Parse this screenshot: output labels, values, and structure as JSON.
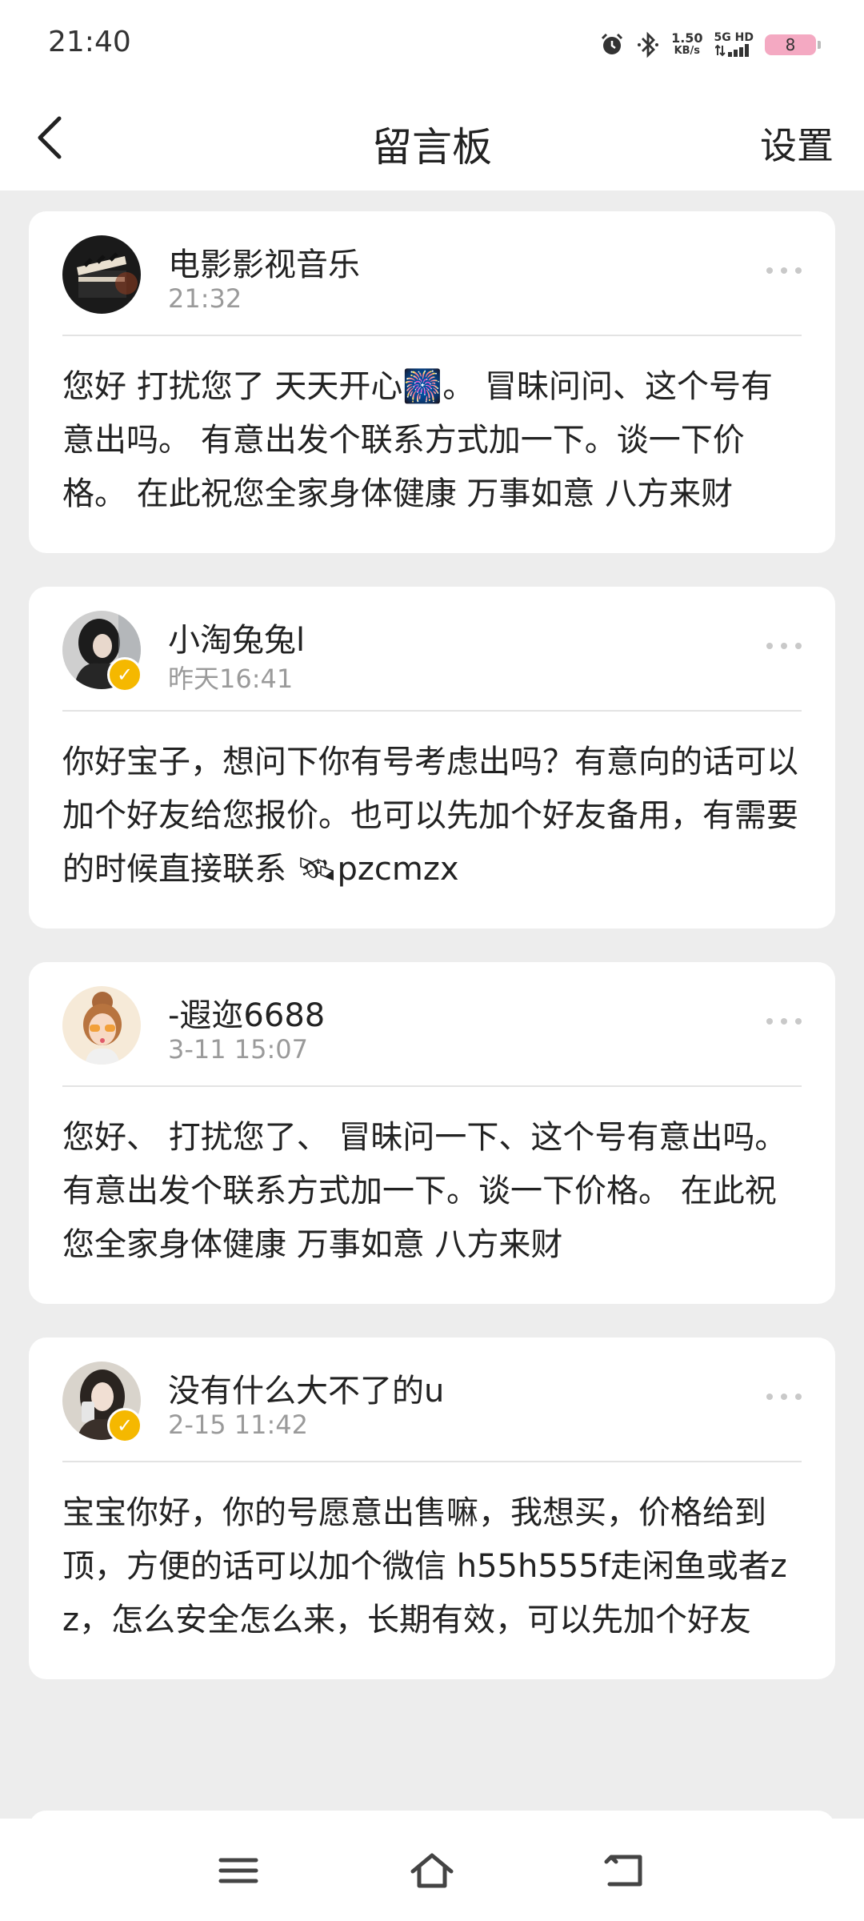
{
  "status": {
    "time": "21:40",
    "speed_value": "1.50",
    "speed_unit": "KB/s",
    "network": "5G HD",
    "battery": "8"
  },
  "header": {
    "title": "留言板",
    "settings_label": "设置"
  },
  "messages": [
    {
      "name": "电影影视音乐",
      "time": "21:32",
      "verified": false,
      "text": "您好 打扰您了  天天开心🎆。        冒昧问问、这个号有意出吗。  有意出发个联系方式加一下。谈一下价格。   在此祝您全家身体健康 万事如意 八方来财"
    },
    {
      "name": "小淘兔兔l",
      "time": "昨天16:41",
      "verified": true,
      "text": "你好宝子，想问下你有号考虑出吗？有意向的话可以加个好友给您报价。也可以先加个好友备用，有需要的时候直接联系 🛰pzcmzx"
    },
    {
      "name": "-遐迩6688",
      "time": "3-11 15:07",
      "verified": false,
      "text": "您好、 打扰您了、 冒昧问一下、这个号有意出吗。  有意出发个联系方式加一下。谈一下价格。   在此祝您全家身体健康 万事如意 八方来财"
    },
    {
      "name": "没有什么大不了的u",
      "time": "2-15 11:42",
      "verified": true,
      "text": "宝宝你好，你的号愿意出售嘛，我想买，价格给到顶，方便的话可以加个微信  h55h555f走闲鱼或者zz，怎么安全怎么来，长期有效，可以先加个好友"
    }
  ],
  "icons": {
    "back": "chevron-left-icon",
    "more": "more-dots-icon",
    "verified": "verified-badge-icon",
    "nav_menu": "menu-icon",
    "nav_home": "home-icon",
    "nav_back": "back-icon"
  },
  "colors": {
    "background": "#ededed",
    "card": "#ffffff",
    "secondary_text": "#9a9a9a",
    "badge": "#f5b800",
    "battery": "#f4a9c2"
  }
}
